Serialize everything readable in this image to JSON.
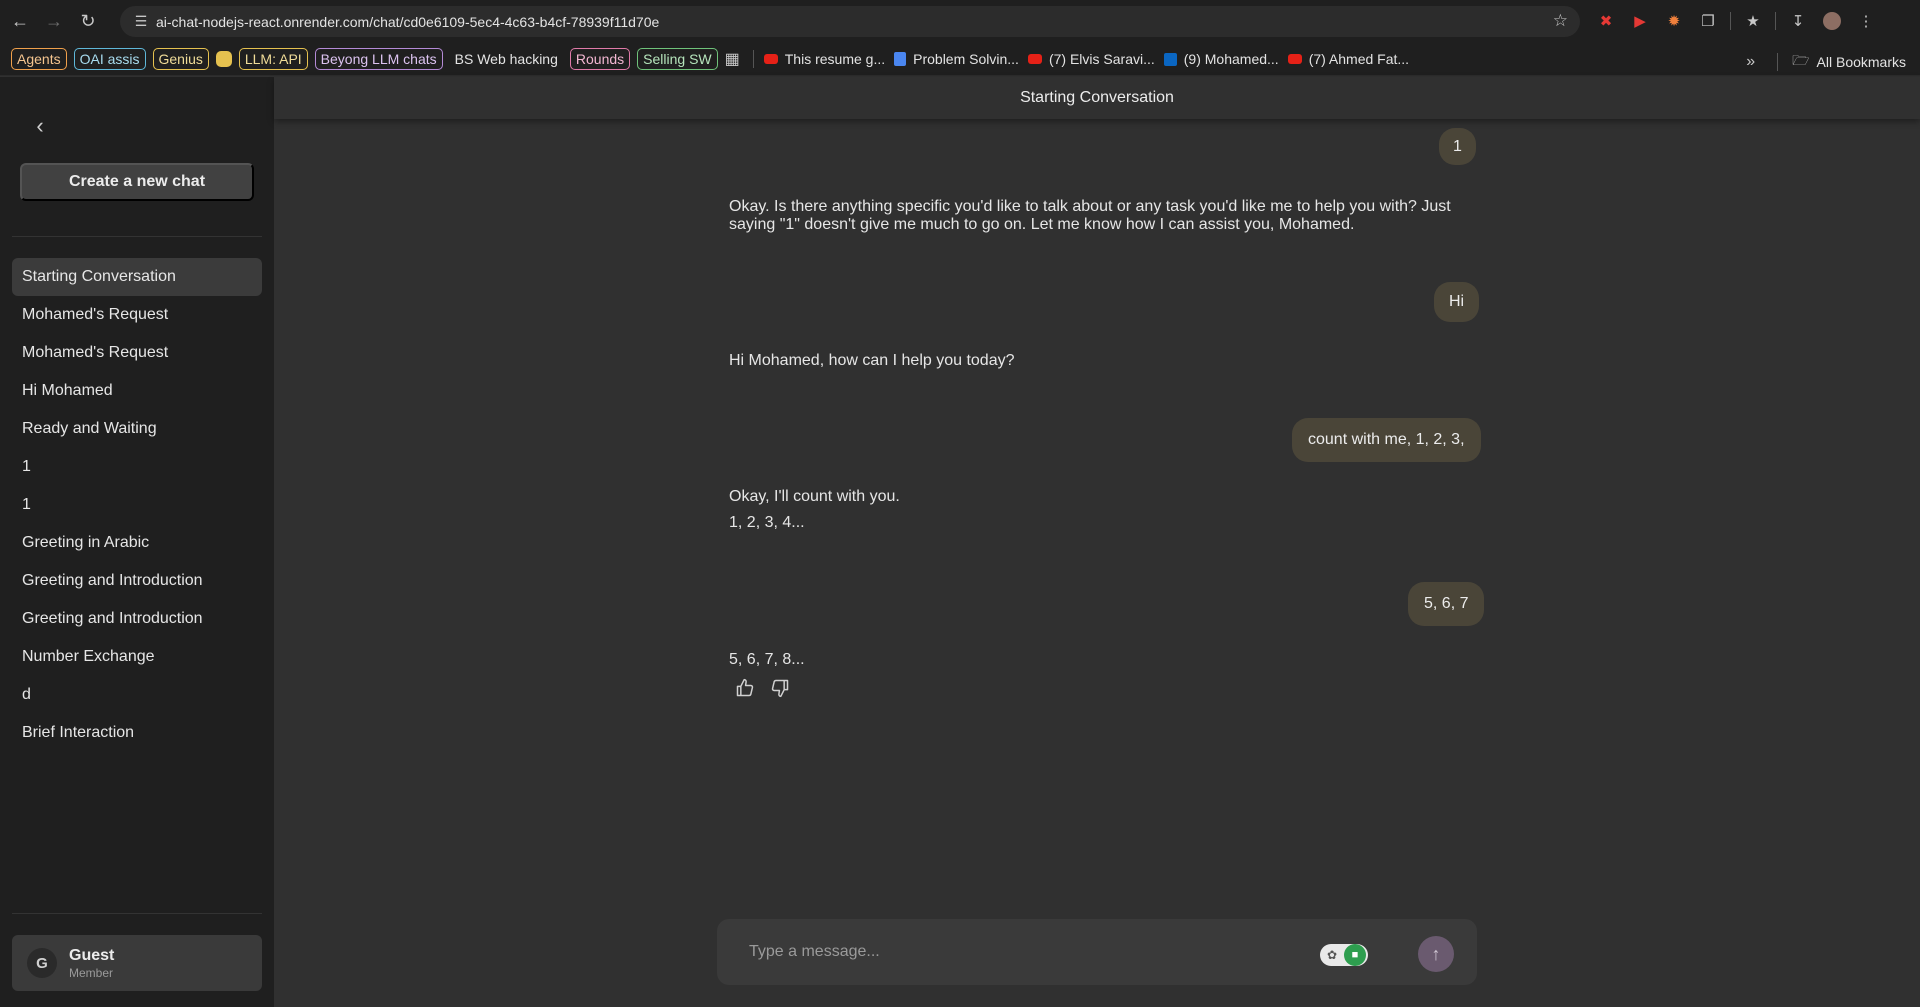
{
  "browser": {
    "url": "ai-chat-nodejs-react.onrender.com/chat/cd0e6109-5ec4-4c63-b4cf-78939f11d70e",
    "bookmarks_chips": [
      {
        "label": "Agents",
        "color": "#f0a04b"
      },
      {
        "label": "OAI assis",
        "color": "#5fb8d9"
      },
      {
        "label": "Genius",
        "color": "#e5c14f"
      },
      {
        "label": "",
        "color": "#e5c14f"
      },
      {
        "label": "LLM: API",
        "color": "#e5c14f"
      },
      {
        "label": "Beyong LLM chats",
        "color": "#b48ad6"
      }
    ],
    "bookmarks_plain_1": "BS Web hacking",
    "bookmarks_chips_2": [
      {
        "label": "Rounds",
        "color": "#e07aa8"
      },
      {
        "label": "Selling SW",
        "color": "#6fc27a"
      }
    ],
    "bookmarks_links": [
      {
        "label": "This resume g...",
        "icon": "youtube-icon"
      },
      {
        "label": "Problem Solvin...",
        "icon": "docs-icon"
      },
      {
        "label": "(7) Elvis Saravi...",
        "icon": "youtube-icon"
      },
      {
        "label": "(9) Mohamed...",
        "icon": "linkedin-icon"
      },
      {
        "label": "(7) Ahmed Fat...",
        "icon": "youtube-icon"
      }
    ],
    "all_bookmarks": "All Bookmarks"
  },
  "sidebar": {
    "new_chat_label": "Create a new chat",
    "chats": [
      "Starting Conversation",
      "Mohamed's Request",
      "Mohamed's Request",
      "Hi Mohamed",
      "Ready and Waiting",
      "1",
      "1",
      "Greeting in Arabic",
      "Greeting and Introduction",
      "Greeting and Introduction",
      "Number Exchange",
      "d",
      "Brief Interaction"
    ],
    "active_index": 0,
    "user": {
      "initial": "G",
      "name": "Guest",
      "role": "Member"
    }
  },
  "chat": {
    "title": "Starting Conversation",
    "messages": {
      "user1": "1",
      "bot1": "Okay. Is there anything specific you'd like to talk about or any task you'd like me to help you with? Just saying \"1\" doesn't give me much to go on. Let me know how I can assist you, Mohamed.",
      "user2": "Hi",
      "bot2": "Hi Mohamed, how can I help you today?",
      "user3": "count with me, 1, 2, 3,",
      "bot3_line1": "Okay, I'll count with you.",
      "bot3_line2": "1, 2, 3, 4...",
      "user4": "5, 6, 7",
      "bot4": "5, 6, 7, 8..."
    },
    "composer_placeholder": "Type a message..."
  }
}
